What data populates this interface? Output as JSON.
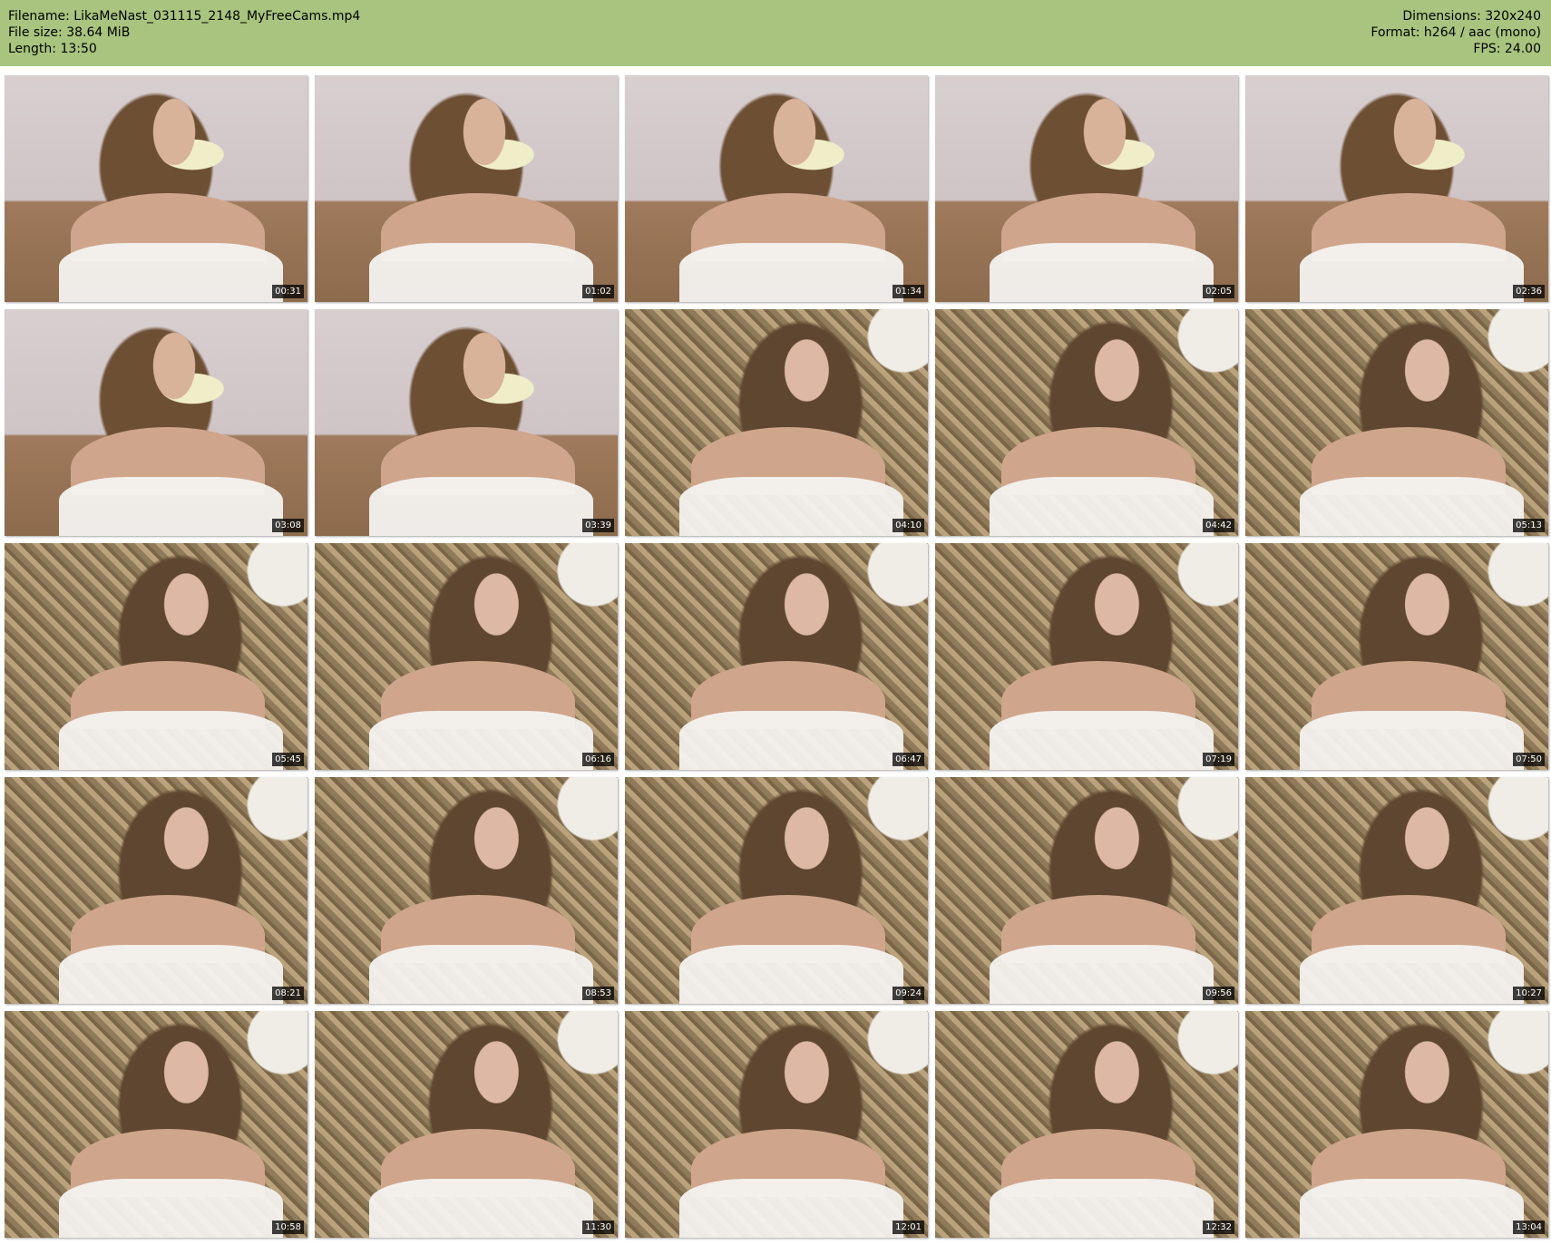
{
  "header": {
    "filename": "Filename: LikaMeNast_031115_2148_MyFreeCams.mp4",
    "filesize": "File size: 38.64 MiB",
    "length": "Length: 13:50",
    "dimensions": "Dimensions: 320x240",
    "format": "Format: h264 / aac (mono)",
    "fps": "FPS: 24.00"
  },
  "colors": {
    "header_background": "#a8c47e",
    "timestamp_background": "#000000",
    "timestamp_text": "#ffffff"
  },
  "thumbnails": [
    {
      "timestamp": "00:31",
      "scene": "a"
    },
    {
      "timestamp": "01:02",
      "scene": "a"
    },
    {
      "timestamp": "01:34",
      "scene": "a"
    },
    {
      "timestamp": "02:05",
      "scene": "a"
    },
    {
      "timestamp": "02:36",
      "scene": "a"
    },
    {
      "timestamp": "03:08",
      "scene": "a"
    },
    {
      "timestamp": "03:39",
      "scene": "a"
    },
    {
      "timestamp": "04:10",
      "scene": "b"
    },
    {
      "timestamp": "04:42",
      "scene": "b"
    },
    {
      "timestamp": "05:13",
      "scene": "b"
    },
    {
      "timestamp": "05:45",
      "scene": "b"
    },
    {
      "timestamp": "06:16",
      "scene": "b"
    },
    {
      "timestamp": "06:47",
      "scene": "b"
    },
    {
      "timestamp": "07:19",
      "scene": "b"
    },
    {
      "timestamp": "07:50",
      "scene": "b"
    },
    {
      "timestamp": "08:21",
      "scene": "b"
    },
    {
      "timestamp": "08:53",
      "scene": "b"
    },
    {
      "timestamp": "09:24",
      "scene": "b"
    },
    {
      "timestamp": "09:56",
      "scene": "b"
    },
    {
      "timestamp": "10:27",
      "scene": "b"
    },
    {
      "timestamp": "10:58",
      "scene": "b"
    },
    {
      "timestamp": "11:30",
      "scene": "b"
    },
    {
      "timestamp": "12:01",
      "scene": "b"
    },
    {
      "timestamp": "12:32",
      "scene": "b"
    },
    {
      "timestamp": "13:04",
      "scene": "b"
    }
  ]
}
